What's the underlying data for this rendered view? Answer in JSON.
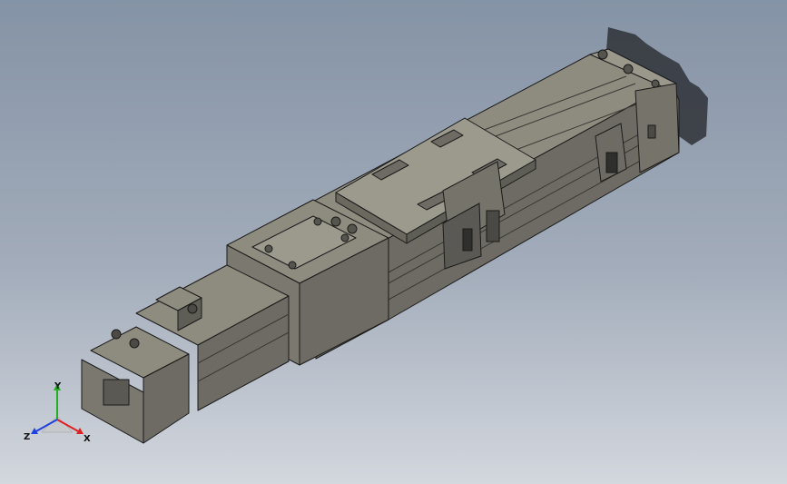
{
  "triad": {
    "x_label": "X",
    "y_label": "Y",
    "z_label": "Z",
    "x_color": "#e02020",
    "y_color": "#20b020",
    "z_color": "#2040e0"
  },
  "colors": {
    "background_top": "#8593a6",
    "background_bottom": "#d3d7de",
    "part_light": "#8e8b7f",
    "part_mid": "#75736a",
    "part_dark": "#55544e",
    "edge": "#1a1a1a",
    "shadow": "#2f3137"
  },
  "icons": [
    "coordinate-triad-icon"
  ]
}
